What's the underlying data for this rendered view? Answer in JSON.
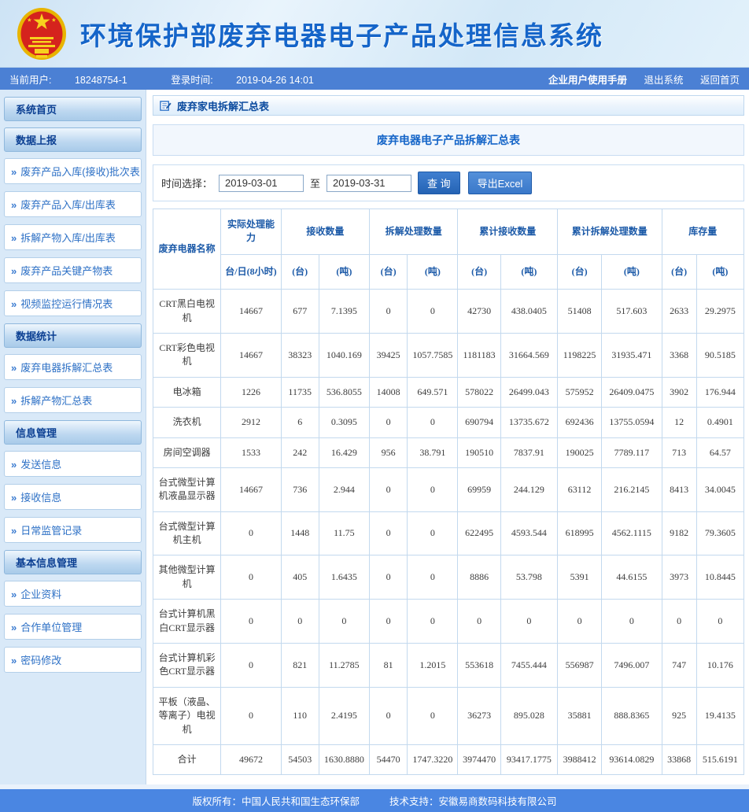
{
  "header": {
    "title": "环境保护部废弃电器电子产品处理信息系统"
  },
  "userbar": {
    "current_user_label": "当前用户:",
    "current_user": "18248754-1",
    "login_time_label": "登录时间:",
    "login_time": "2019-04-26 14:01",
    "link_manual": "企业用户使用手册",
    "link_logout": "退出系统",
    "link_home": "返回首页"
  },
  "sidebar": {
    "items": [
      {
        "type": "header",
        "label": "系统首页"
      },
      {
        "type": "header",
        "label": "数据上报"
      },
      {
        "type": "item",
        "label": "废弃产品入库(接收)批次表"
      },
      {
        "type": "item",
        "label": "废弃产品入库/出库表"
      },
      {
        "type": "item",
        "label": "拆解产物入库/出库表"
      },
      {
        "type": "item",
        "label": "废弃产品关键产物表"
      },
      {
        "type": "item",
        "label": "视频监控运行情况表"
      },
      {
        "type": "header",
        "label": "数据统计"
      },
      {
        "type": "item",
        "label": "废弃电器拆解汇总表"
      },
      {
        "type": "item",
        "label": "拆解产物汇总表"
      },
      {
        "type": "header",
        "label": "信息管理"
      },
      {
        "type": "item",
        "label": "发送信息"
      },
      {
        "type": "item",
        "label": "接收信息"
      },
      {
        "type": "item",
        "label": "日常监管记录"
      },
      {
        "type": "header",
        "label": "基本信息管理"
      },
      {
        "type": "item",
        "label": "企业资料"
      },
      {
        "type": "item",
        "label": "合作单位管理"
      },
      {
        "type": "item",
        "label": "密码修改"
      }
    ]
  },
  "main": {
    "breadcrumb": "废弃家电拆解汇总表",
    "table_title": "废弃电器电子产品拆解汇总表",
    "filter": {
      "label": "时间选择：",
      "start_date": "2019-03-01",
      "to_label": "至",
      "end_date": "2019-03-31",
      "query_button": "查 询",
      "export_button": "导出Excel"
    },
    "table": {
      "name_header": "废弃电器名称",
      "capacity_header": "实际处理能力",
      "capacity_sub": "台/日(8小时)",
      "groups": [
        "接收数量",
        "拆解处理数量",
        "累计接收数量",
        "累计拆解处理数量",
        "库存量"
      ],
      "unit_tai": "(台)",
      "unit_dun": "(吨)",
      "rows": [
        {
          "name": "CRT黑白电视机",
          "values": [
            "14667",
            "677",
            "7.1395",
            "0",
            "0",
            "42730",
            "438.0405",
            "51408",
            "517.603",
            "2633",
            "29.2975"
          ]
        },
        {
          "name": "CRT彩色电视机",
          "values": [
            "14667",
            "38323",
            "1040.169",
            "39425",
            "1057.7585",
            "1181183",
            "31664.569",
            "1198225",
            "31935.471",
            "3368",
            "90.5185"
          ]
        },
        {
          "name": "电冰箱",
          "values": [
            "1226",
            "11735",
            "536.8055",
            "14008",
            "649.571",
            "578022",
            "26499.043",
            "575952",
            "26409.0475",
            "3902",
            "176.944"
          ]
        },
        {
          "name": "洗衣机",
          "values": [
            "2912",
            "6",
            "0.3095",
            "0",
            "0",
            "690794",
            "13735.672",
            "692436",
            "13755.0594",
            "12",
            "0.4901"
          ]
        },
        {
          "name": "房间空调器",
          "values": [
            "1533",
            "242",
            "16.429",
            "956",
            "38.791",
            "190510",
            "7837.91",
            "190025",
            "7789.117",
            "713",
            "64.57"
          ]
        },
        {
          "name": "台式微型计算机液晶显示器",
          "values": [
            "14667",
            "736",
            "2.944",
            "0",
            "0",
            "69959",
            "244.129",
            "63112",
            "216.2145",
            "8413",
            "34.0045"
          ]
        },
        {
          "name": "台式微型计算机主机",
          "values": [
            "0",
            "1448",
            "11.75",
            "0",
            "0",
            "622495",
            "4593.544",
            "618995",
            "4562.1115",
            "9182",
            "79.3605"
          ]
        },
        {
          "name": "其他微型计算机",
          "values": [
            "0",
            "405",
            "1.6435",
            "0",
            "0",
            "8886",
            "53.798",
            "5391",
            "44.6155",
            "3973",
            "10.8445"
          ]
        },
        {
          "name": "台式计算机黑白CRT显示器",
          "values": [
            "0",
            "0",
            "0",
            "0",
            "0",
            "0",
            "0",
            "0",
            "0",
            "0",
            "0"
          ]
        },
        {
          "name": "台式计算机彩色CRT显示器",
          "values": [
            "0",
            "821",
            "11.2785",
            "81",
            "1.2015",
            "553618",
            "7455.444",
            "556987",
            "7496.007",
            "747",
            "10.176"
          ]
        },
        {
          "name": "平板（液晶、等离子）电视机",
          "values": [
            "0",
            "110",
            "2.4195",
            "0",
            "0",
            "36273",
            "895.028",
            "35881",
            "888.8365",
            "925",
            "19.4135"
          ]
        }
      ],
      "total_label": "合计",
      "total_values": [
        "49672",
        "54503",
        "1630.8880",
        "54470",
        "1747.3220",
        "3974470",
        "93417.1775",
        "3988412",
        "93614.0829",
        "33868",
        "515.6191"
      ]
    }
  },
  "footer": {
    "copyright": "版权所有：中国人民共和国生态环保部",
    "support": "技术支持：安徽易商数码科技有限公司"
  },
  "colors": {
    "accent_blue": "#1565c9",
    "bar_blue": "#4b80d4",
    "footer_blue": "#4a86e2",
    "table_border": "#c3d9ee",
    "emblem_red": "#d5231d",
    "emblem_gold": "#f0c010"
  }
}
